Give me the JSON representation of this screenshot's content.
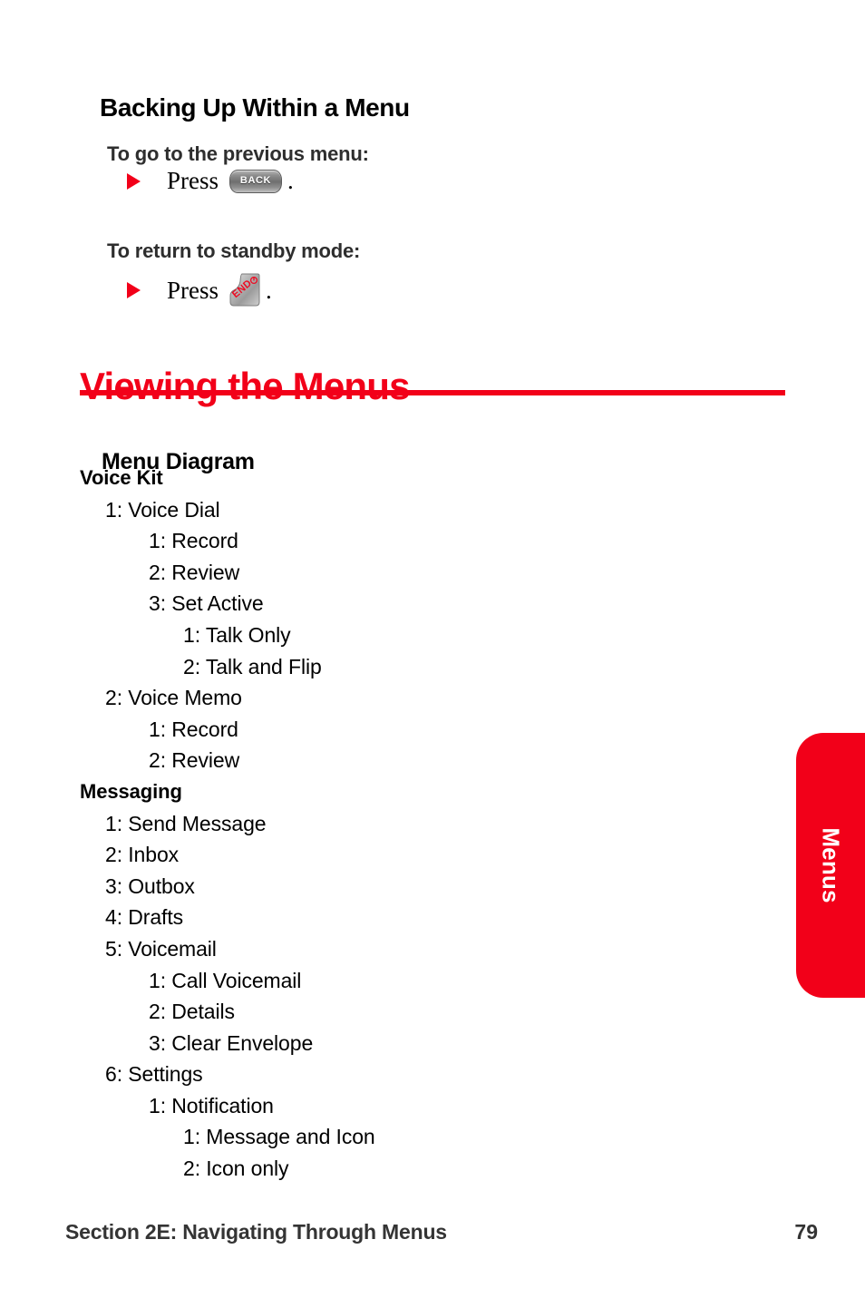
{
  "page": {
    "section_heading": "Backing Up Within a Menu",
    "task_1": "To go to the previous menu:",
    "task_2": "To return to standby mode:",
    "press_word": "Press",
    "period": ".",
    "title": "Viewing the Menus",
    "subheading": "Menu Diagram"
  },
  "keys": {
    "back_label": "BACK",
    "end_label": "END"
  },
  "colors": {
    "brand_red": "#f20019",
    "text_black": "#000000",
    "footer_gray": "#343434",
    "key_gray_light": "#c3c3c3",
    "key_gray_dark": "#6f6f6f"
  },
  "menu_tree": [
    {
      "level": 0,
      "text": "Voice Kit"
    },
    {
      "level": 1,
      "text": "1: Voice Dial"
    },
    {
      "level": 2,
      "text": "1: Record"
    },
    {
      "level": 2,
      "text": "2: Review"
    },
    {
      "level": 2,
      "text": "3: Set Active"
    },
    {
      "level": 3,
      "text": "1: Talk Only"
    },
    {
      "level": 3,
      "text": "2: Talk and Flip"
    },
    {
      "level": 1,
      "text": "2: Voice Memo"
    },
    {
      "level": 2,
      "text": "1: Record"
    },
    {
      "level": 2,
      "text": "2: Review"
    },
    {
      "level": 0,
      "text": "Messaging"
    },
    {
      "level": 1,
      "text": "1: Send Message"
    },
    {
      "level": 1,
      "text": "2: Inbox"
    },
    {
      "level": 1,
      "text": "3: Outbox"
    },
    {
      "level": 1,
      "text": "4: Drafts"
    },
    {
      "level": 1,
      "text": "5: Voicemail"
    },
    {
      "level": 2,
      "text": "1: Call Voicemail"
    },
    {
      "level": 2,
      "text": "2: Details"
    },
    {
      "level": 2,
      "text": "3: Clear Envelope"
    },
    {
      "level": 1,
      "text": "6: Settings"
    },
    {
      "level": 2,
      "text": "1: Notification"
    },
    {
      "level": 3,
      "text": "1: Message and Icon"
    },
    {
      "level": 3,
      "text": "2: Icon only"
    }
  ],
  "side_tab": {
    "label": "Menus"
  },
  "footer": {
    "section": "Section 2E: Navigating Through Menus",
    "page_number": "79"
  }
}
